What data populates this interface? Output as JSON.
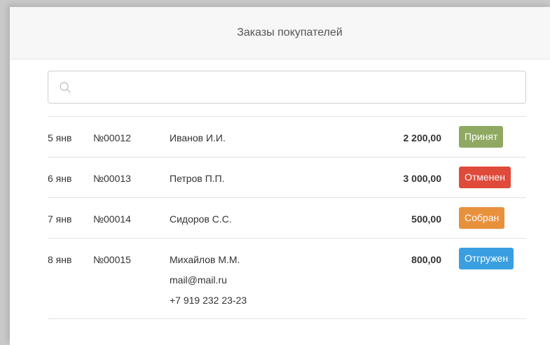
{
  "header": {
    "title": "Заказы покупателей"
  },
  "search": {
    "placeholder": "",
    "value": "",
    "icon": "search-icon"
  },
  "orders": [
    {
      "date": "5 янв",
      "number": "№00012",
      "customer": "Иванов И.И.",
      "sum": "2 200,00",
      "status": "Принят",
      "status_color": "#8fa962"
    },
    {
      "date": "6 янв",
      "number": "№00013",
      "customer": "Петров П.П.",
      "sum": "3 000,00",
      "status": "Отменен",
      "status_color": "#e04a3a"
    },
    {
      "date": "7 янв",
      "number": "№00014",
      "customer": "Сидоров С.С.",
      "sum": "500,00",
      "status": "Собран",
      "status_color": "#e8913d"
    },
    {
      "date": "8 янв",
      "number": "№00015",
      "customer": "Михайлов М.М.",
      "email": "mail@mail.ru",
      "phone": "+7 919 232 23-23",
      "sum": "800,00",
      "status": "Отгружен",
      "status_color": "#3a9fe0"
    }
  ]
}
